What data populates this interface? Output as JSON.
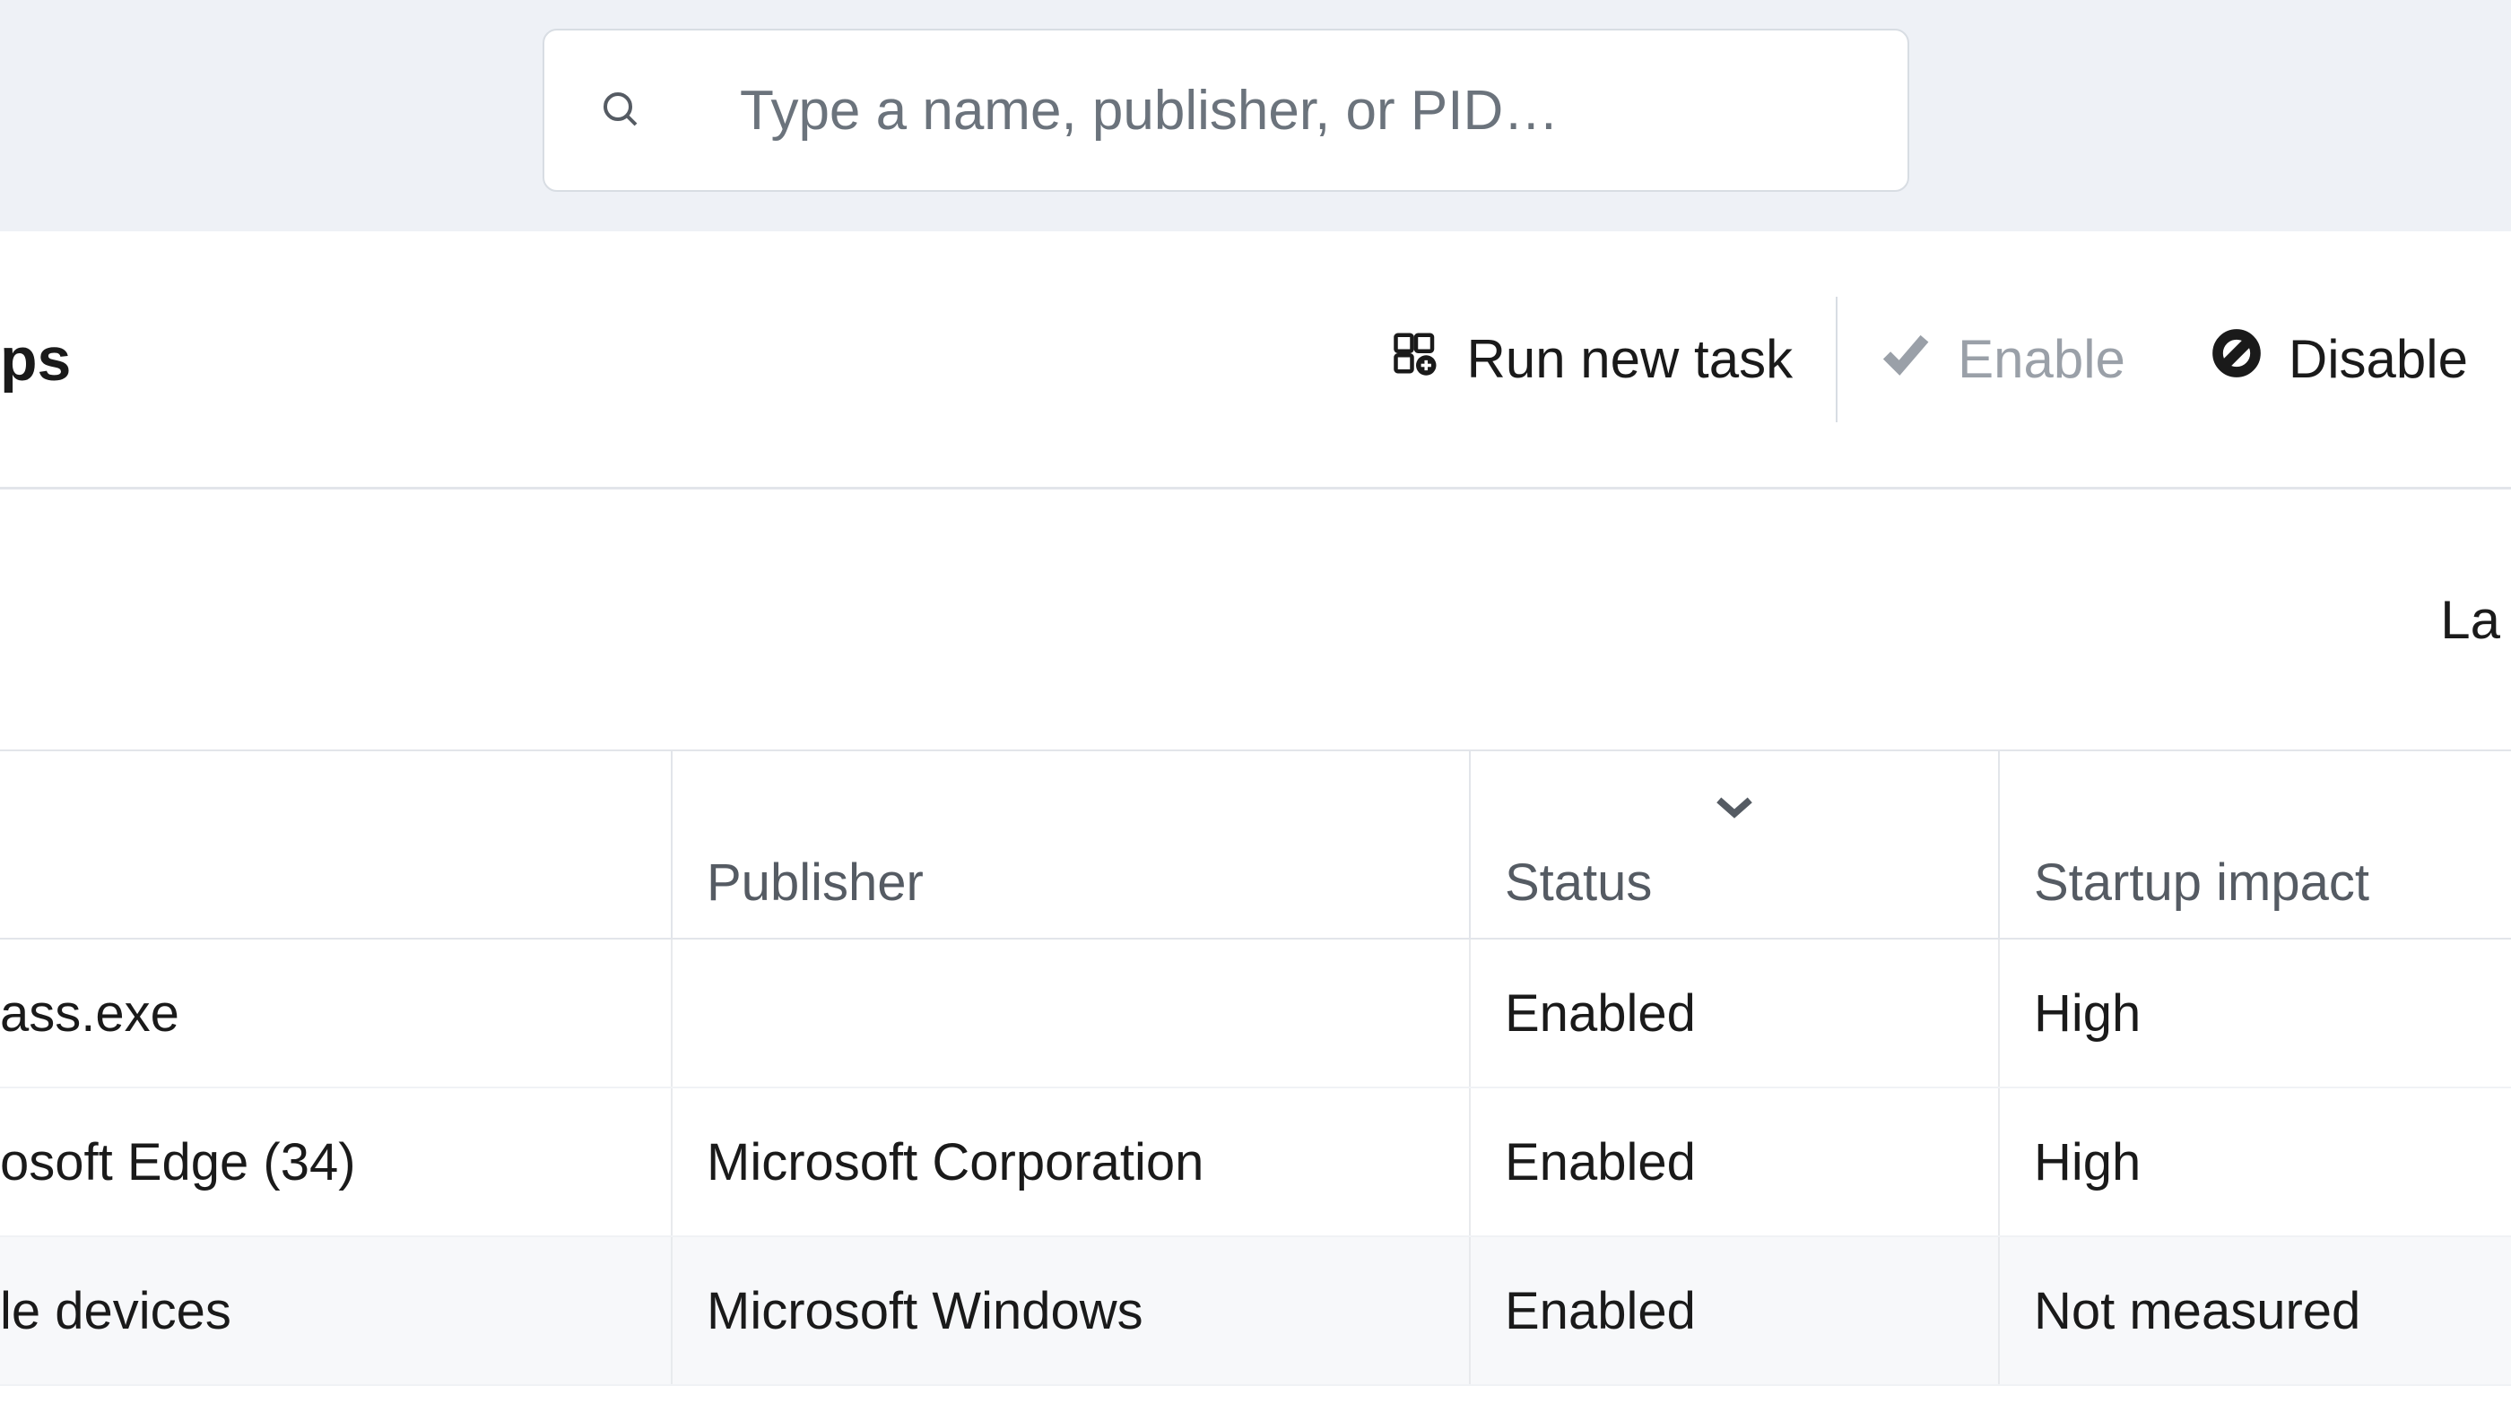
{
  "search": {
    "placeholder": "Type a name, publisher, or PID…"
  },
  "page": {
    "title_fragment": "ps"
  },
  "toolbar": {
    "run_task": "Run new task",
    "enable": "Enable",
    "disable": "Disable"
  },
  "sub_header": {
    "la_fragment": "La"
  },
  "table": {
    "headers": {
      "name": "",
      "publisher": "Publisher",
      "status": "Status",
      "impact": "Startup impact"
    },
    "rows": [
      {
        "name": "ass.exe",
        "publisher": "",
        "status": "Enabled",
        "impact": "High"
      },
      {
        "name": "osoft Edge (34)",
        "publisher": "Microsoft Corporation",
        "status": "Enabled",
        "impact": "High"
      },
      {
        "name": "le devices",
        "publisher": "Microsoft Windows",
        "status": "Enabled",
        "impact": "Not measured"
      }
    ]
  }
}
